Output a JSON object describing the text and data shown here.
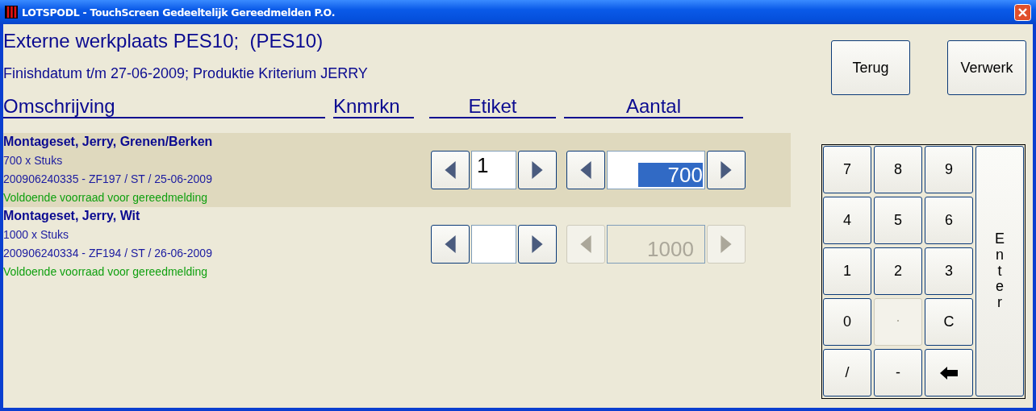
{
  "window": {
    "title": "LOTSPODL - TouchScreen Gedeeltelijk Gereedmelden P.O."
  },
  "header": {
    "title": "Externe werkplaats PES10;  (PES10)",
    "subtitle": "Finishdatum t/m 27-06-2009; Produktie Kriterium JERRY"
  },
  "buttons": [
    "Terug",
    "Verwerk"
  ],
  "columns": [
    {
      "label": "Omschrijving",
      "kind": "left"
    },
    {
      "label": "Knmrkn",
      "kind": "left"
    },
    {
      "label": "Etiket",
      "kind": "center"
    },
    {
      "label": "Aantal",
      "kind": "center"
    }
  ],
  "rows": [
    {
      "name": "Montageset, Jerry, Grenen/Berken",
      "quantity": "700 x Stuks",
      "reference": "200906240335 - ZF197 / ST / 25-06-2009",
      "status": "Voldoende voorraad voor gereedmelding",
      "selected": true,
      "etiket": {
        "value": "1",
        "disabled": false
      },
      "aantal": {
        "value": "700",
        "disabled": false,
        "text_selected": true
      }
    },
    {
      "name": "Montageset, Jerry, Wit",
      "quantity": "1000 x Stuks",
      "reference": "200906240334 - ZF194 / ST / 26-06-2009",
      "status": "Voldoende voorraad voor gereedmelding",
      "selected": false,
      "etiket": {
        "disabled": false
      },
      "aantal": {
        "value": "1000",
        "disabled": true,
        "text_selected": false
      }
    }
  ],
  "keypad": {
    "keys": [
      {
        "kind": "char",
        "label": "7",
        "disabled": false
      },
      {
        "kind": "char",
        "label": "8",
        "disabled": false
      },
      {
        "kind": "char",
        "label": "9",
        "disabled": false
      },
      {
        "kind": "char",
        "label": "4",
        "disabled": false
      },
      {
        "kind": "char",
        "label": "5",
        "disabled": false
      },
      {
        "kind": "char",
        "label": "6",
        "disabled": false
      },
      {
        "kind": "char",
        "label": "1",
        "disabled": false
      },
      {
        "kind": "char",
        "label": "2",
        "disabled": false
      },
      {
        "kind": "char",
        "label": "3",
        "disabled": false
      },
      {
        "kind": "char",
        "label": "0",
        "disabled": false
      },
      {
        "kind": "char",
        "label": ".",
        "disabled": true
      },
      {
        "kind": "char",
        "label": "C",
        "disabled": false
      },
      {
        "kind": "char",
        "label": "/",
        "disabled": false
      },
      {
        "kind": "char",
        "label": "-",
        "disabled": false
      },
      {
        "kind": "backspace",
        "disabled": false
      }
    ],
    "enter": "Enter"
  }
}
